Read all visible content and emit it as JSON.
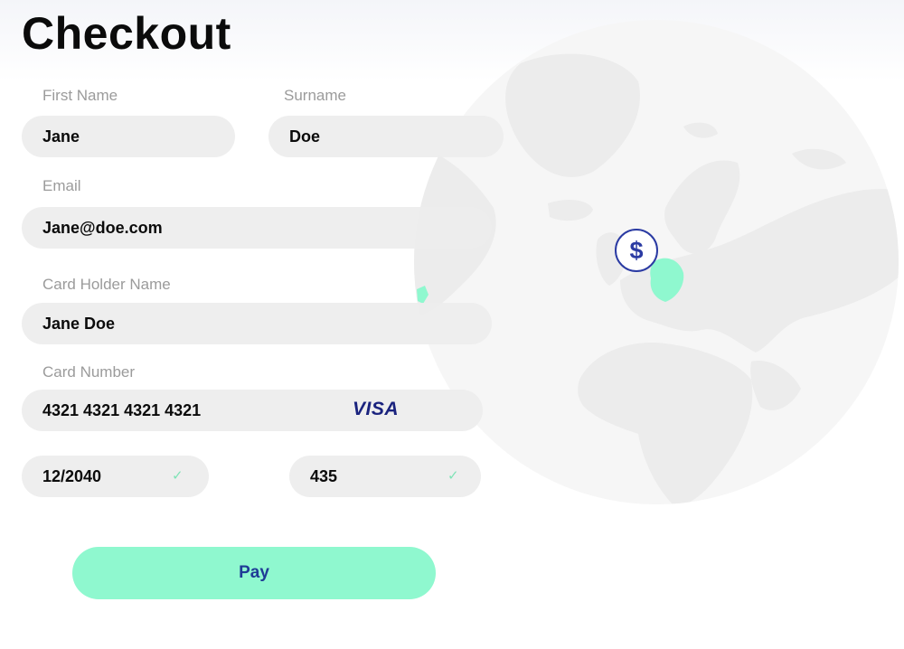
{
  "page": {
    "title": "Checkout"
  },
  "form": {
    "first_name": {
      "label": "First Name",
      "value": "Jane"
    },
    "surname": {
      "label": "Surname",
      "value": "Doe"
    },
    "email": {
      "label": "Email",
      "value": "Jane@doe.com"
    },
    "card_holder": {
      "label": "Card Holder Name",
      "value": "Jane Doe"
    },
    "card_number": {
      "label": "Card Number",
      "value": "4321 4321 4321 4321",
      "brand": "VISA"
    },
    "expiry": {
      "value": "12/2040",
      "valid": true
    },
    "cvv": {
      "value": "435",
      "valid": true
    },
    "check_glyph": "✓"
  },
  "pay_button": {
    "label": "Pay"
  },
  "map": {
    "pin_symbol": "$",
    "highlight_color": "#8ff8cf",
    "land_color": "#ececec",
    "accent_color": "#2b3ba3"
  }
}
